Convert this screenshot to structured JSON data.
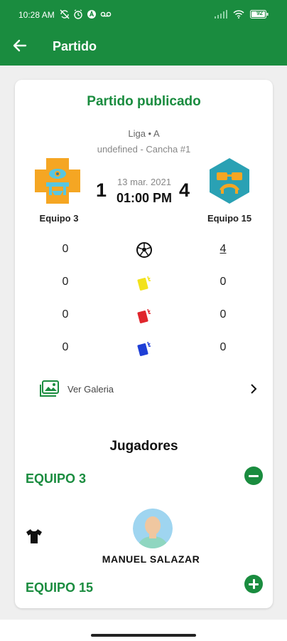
{
  "status_bar": {
    "time": "10:28 AM",
    "battery": "92"
  },
  "app_bar": {
    "title": "Partido"
  },
  "match": {
    "status_title": "Partido publicado",
    "league": "Liga • A",
    "venue": "undefined - Cancha #1",
    "date": "13 mar. 2021",
    "time": "01:00 PM",
    "home": {
      "name": "Equipo 3",
      "score": "1"
    },
    "away": {
      "name": "Equipo 15",
      "score": "4"
    }
  },
  "stats": [
    {
      "icon": "soccer-ball-icon",
      "home": "0",
      "away": "4"
    },
    {
      "icon": "yellow-card-icon",
      "home": "0",
      "away": "0",
      "color": "#f2e21b"
    },
    {
      "icon": "red-card-icon",
      "home": "0",
      "away": "0",
      "color": "#e0262d"
    },
    {
      "icon": "blue-card-icon",
      "home": "0",
      "away": "0",
      "color": "#1f3fd6"
    }
  ],
  "gallery": {
    "label": "Ver Galeria"
  },
  "players": {
    "section_title": "Jugadores",
    "teams": [
      {
        "name": "EQUIPO 3",
        "expanded": true,
        "players": [
          {
            "name": "MANUEL  SALAZAR"
          }
        ]
      },
      {
        "name": "EQUIPO 15",
        "expanded": false
      }
    ]
  },
  "colors": {
    "primary": "#1a8c3f",
    "home_logo": "#f5a623",
    "away_logo": "#2aa1b4"
  }
}
